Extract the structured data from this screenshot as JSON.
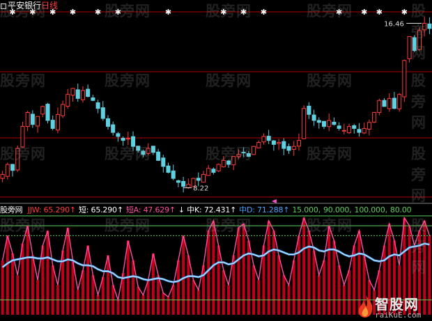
{
  "header": {
    "stock_name": "平安银行",
    "period": "日线"
  },
  "colors": {
    "up": "#ff3b3b",
    "down": "#5fd0e0",
    "white": "#ffffff",
    "green": "#5dd05d",
    "blue": "#4aa3ff",
    "red_guide": "#b00000",
    "pink": "#ff4fa0"
  },
  "indicator": {
    "title": "股旁网",
    "items": [
      {
        "label": "JJW:",
        "value": "65.290",
        "arrow": "↑",
        "color": "#ff3b3b"
      },
      {
        "label": "短:",
        "value": "65.290",
        "arrow": "↑",
        "color": "#ffffff"
      },
      {
        "label": "短A:",
        "value": "47.629",
        "arrow": "↑",
        "color": "#ff4fa0"
      },
      {
        "label": "↓ 中K:",
        "value": "72.431",
        "arrow": "↑",
        "color": "#ffffff"
      },
      {
        "label": "中D:",
        "value": "71.288",
        "arrow": "↑",
        "color": "#4aa3ff"
      },
      {
        "label": "",
        "value": "15.000,",
        "arrow": "",
        "color": "#5dd05d"
      },
      {
        "label": "",
        "value": "90.000,",
        "arrow": "",
        "color": "#5dd05d"
      },
      {
        "label": "",
        "value": "100.000,",
        "arrow": "",
        "color": "#5dd05d"
      },
      {
        "label": "",
        "value": "80.00",
        "arrow": "",
        "color": "#5dd05d"
      }
    ]
  },
  "watermarks": [
    "股旁网",
    "股旁网",
    "股旁网",
    "股旁网",
    "股旁网",
    "股旁网",
    "股旁网",
    "股旁网",
    "股旁网",
    "股旁网",
    "股旁网",
    "股旁网",
    "股旁网",
    "股旁网",
    "股旁网",
    "股旁网",
    "股旁网",
    "股旁网",
    "股旁网",
    "股旁网"
  ],
  "logo": {
    "main": "智股网",
    "sub": "raiKuE.com"
  },
  "chart_data": {
    "type": "candlestick_with_oscillator",
    "price_panel": {
      "min_label": "8.22",
      "max_label": "16.46",
      "close": [
        8.9,
        9.4,
        9.1,
        10.2,
        11.3,
        12.0,
        11.4,
        11.8,
        12.3,
        11.6,
        11.2,
        11.9,
        12.4,
        12.9,
        13.2,
        12.7,
        13.1,
        12.8,
        12.6,
        12.2,
        11.7,
        11.3,
        11.0,
        10.8,
        10.6,
        10.7,
        10.3,
        10.1,
        9.9,
        10.2,
        10.0,
        9.6,
        9.3,
        9.0,
        8.7,
        8.5,
        8.3,
        8.4,
        8.7,
        8.6,
        8.9,
        9.2,
        9.0,
        9.4,
        9.6,
        9.4,
        9.8,
        9.9,
        10.0,
        9.8,
        10.3,
        10.5,
        10.8,
        10.6,
        10.4,
        10.5,
        10.2,
        10.1,
        10.3,
        10.6,
        12.2,
        11.9,
        11.6,
        11.5,
        11.3,
        11.6,
        11.4,
        11.2,
        11.1,
        11.3,
        11.2,
        11.0,
        11.2,
        11.5,
        12.0,
        12.6,
        12.3,
        12.7,
        12.2,
        12.9,
        14.6,
        15.8,
        15.1,
        16.1,
        16.46,
        16.2
      ],
      "signal_stars_upper": [
        2,
        6,
        10,
        14,
        19,
        23,
        33,
        44,
        48,
        52,
        67,
        72,
        75,
        80
      ],
      "signal_marks_lower": [
        54
      ]
    },
    "oscillator_panel": {
      "series": [
        {
          "name": "JJW",
          "values": [
            55,
            80,
            62,
            40,
            72,
            90,
            60,
            35,
            70,
            85,
            50,
            30,
            65,
            88,
            55,
            25,
            45,
            70,
            40,
            20,
            38,
            60,
            30,
            15,
            42,
            75,
            55,
            28,
            20,
            35,
            62,
            40,
            22,
            18,
            30,
            55,
            80,
            60,
            35,
            25,
            50,
            85,
            95,
            70,
            45,
            30,
            60,
            88,
            92,
            75,
            50,
            35,
            70,
            95,
            85,
            60,
            40,
            30,
            55,
            80,
            98,
            85,
            65,
            40,
            55,
            90,
            75,
            50,
            30,
            45,
            70,
            85,
            60,
            35,
            25,
            45,
            70,
            92,
            75,
            50,
            98,
            90,
            70,
            85,
            95,
            80
          ]
        },
        {
          "name": "中D",
          "values": [
            48,
            52,
            55,
            56,
            57,
            58,
            58,
            57,
            57,
            58,
            56,
            54,
            54,
            56,
            55,
            52,
            50,
            50,
            49,
            46,
            44,
            44,
            42,
            38,
            37,
            38,
            39,
            38,
            36,
            35,
            36,
            37,
            36,
            34,
            33,
            34,
            37,
            39,
            39,
            38,
            40,
            45,
            50,
            53,
            53,
            51,
            52,
            56,
            60,
            62,
            61,
            59,
            60,
            64,
            66,
            65,
            63,
            61,
            61,
            63,
            67,
            69,
            68,
            65,
            64,
            66,
            66,
            64,
            61,
            59,
            60,
            62,
            61,
            58,
            55,
            54,
            55,
            59,
            61,
            60,
            64,
            68,
            69,
            70,
            72,
            71
          ]
        }
      ],
      "ylim": [
        0,
        100
      ],
      "guide_lines": [
        15,
        90,
        100,
        80
      ]
    }
  }
}
